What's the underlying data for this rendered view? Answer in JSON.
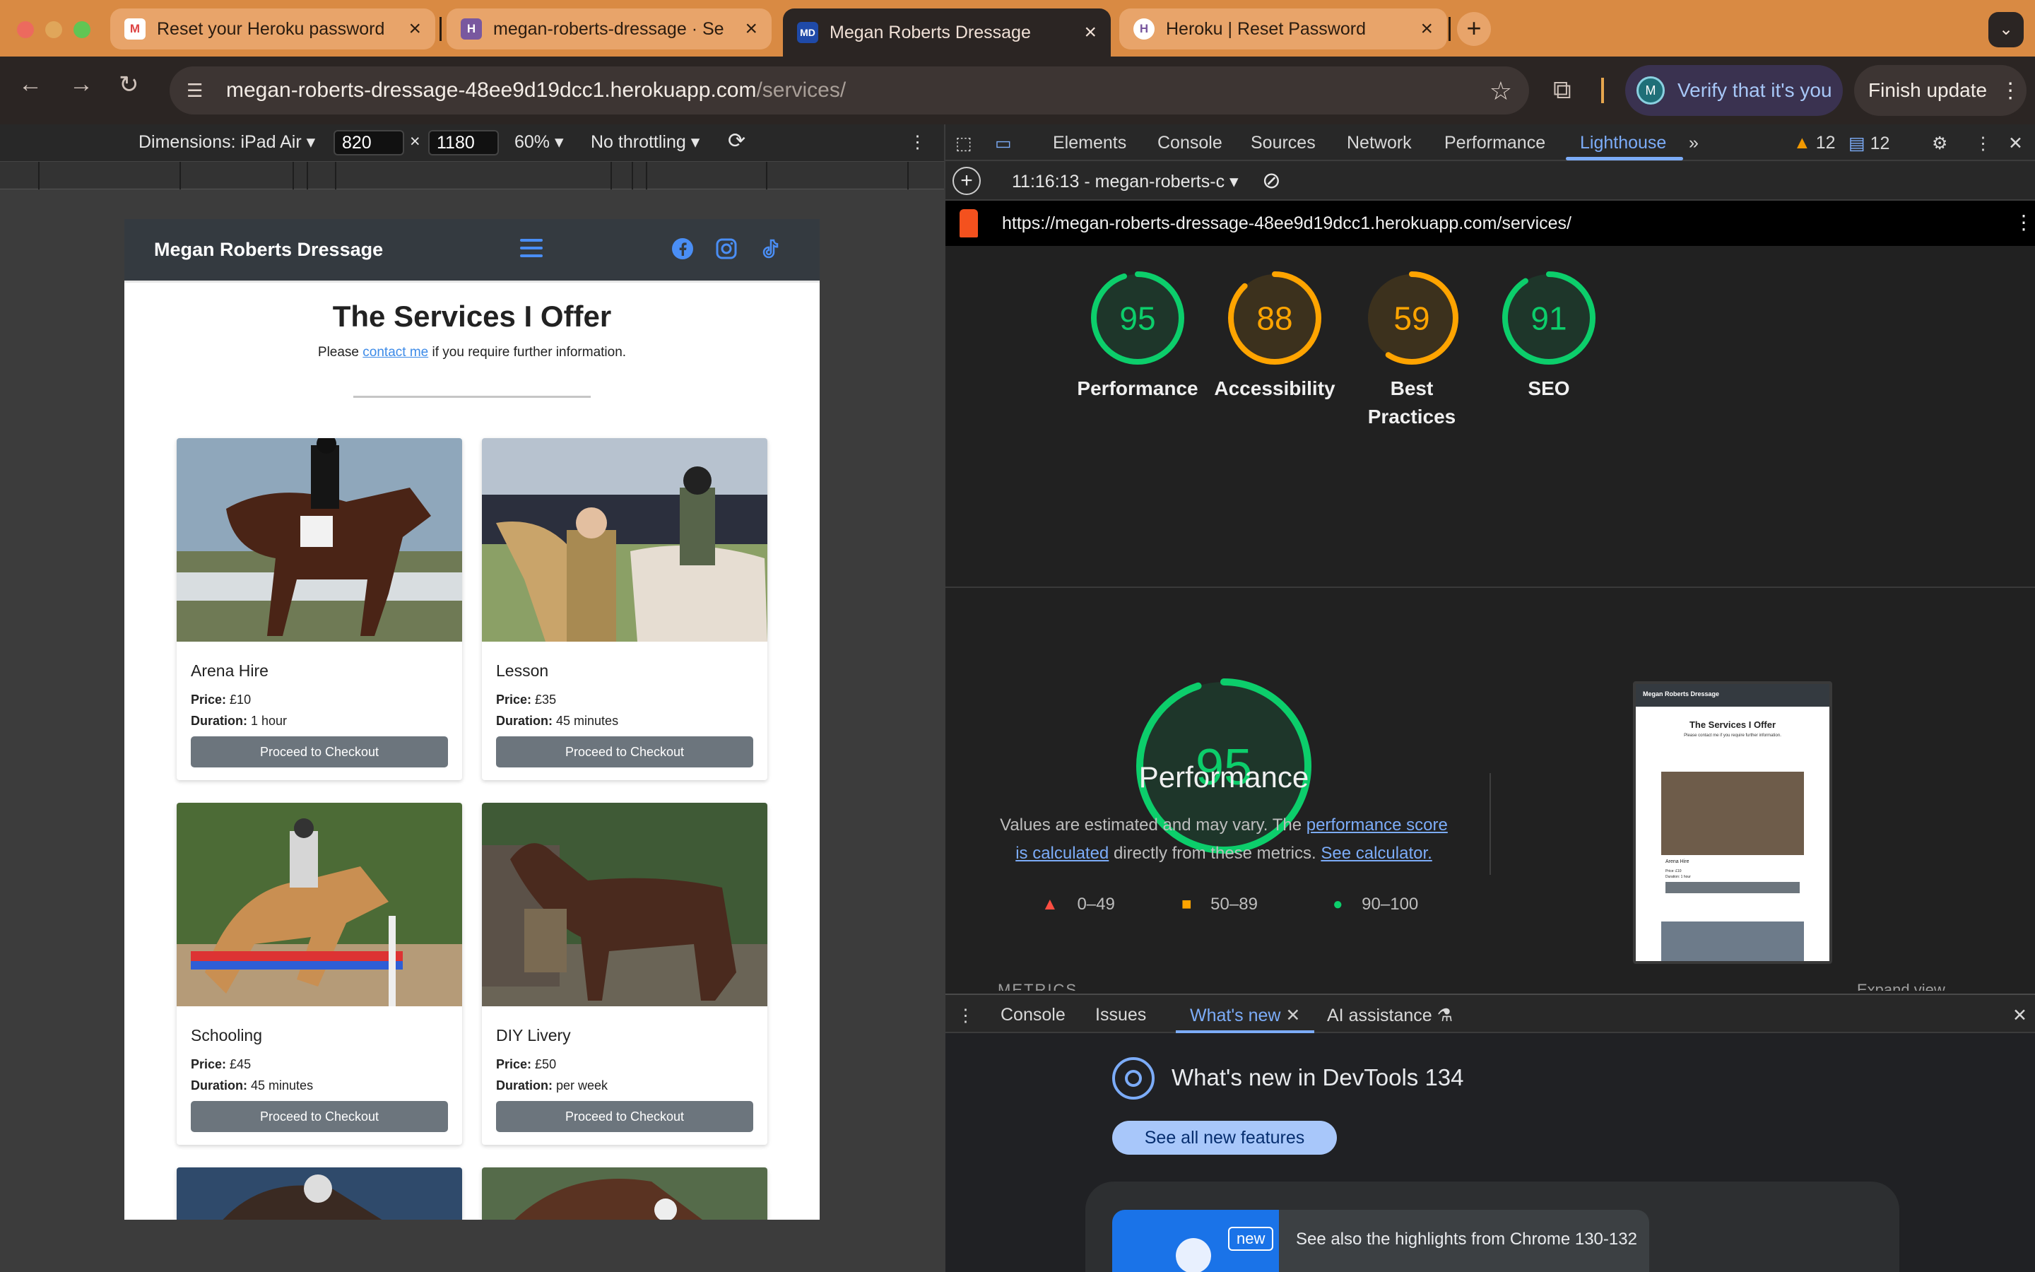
{
  "browser": {
    "tabs": [
      {
        "label": "Reset your Heroku password",
        "favicon": "gmail-icon"
      },
      {
        "label": "megan-roberts-dressage · Se",
        "favicon": "heroku-icon"
      },
      {
        "label": "Megan Roberts Dressage",
        "favicon": "site-icon",
        "favicon_text": "MD"
      },
      {
        "label": "Heroku | Reset Password",
        "favicon": "heroku-icon"
      }
    ],
    "url_host": "megan-roberts-dressage-48ee9d19dcc1.herokuapp.com",
    "url_path": "/services/",
    "verify_label": "Verify that it's you",
    "avatar_letter": "M",
    "finish_update_label": "Finish update",
    "accent": "#d98a43"
  },
  "device_toolbar": {
    "dimensions_label": "Dimensions: iPad Air",
    "width": "820",
    "times": "×",
    "height": "1180",
    "zoom": "60%",
    "throttling": "No throttling"
  },
  "site": {
    "brand": "Megan Roberts Dressage",
    "title": "The Services I Offer",
    "subtitle_before": "Please ",
    "subtitle_link": "contact me",
    "subtitle_after": " if you require further information.",
    "price_label": "Price:",
    "duration_label": "Duration:",
    "cards": [
      {
        "title": "Arena Hire",
        "price": "£10",
        "duration": "1 hour",
        "button": "Proceed to Checkout"
      },
      {
        "title": "Lesson",
        "price": "£35",
        "duration": "45 minutes",
        "button": "Proceed to Checkout"
      },
      {
        "title": "Schooling",
        "price": "£45",
        "duration": "45 minutes",
        "button": "Proceed to Checkout"
      },
      {
        "title": "DIY Livery",
        "price": "£50",
        "duration": "per week",
        "button": "Proceed to Checkout"
      }
    ]
  },
  "devtools": {
    "tabs": [
      "Elements",
      "Console",
      "Sources",
      "Network",
      "Performance",
      "Lighthouse"
    ],
    "warnings_count": "12",
    "messages_count": "12",
    "report_time": "11:16:13 - megan-roberts-c",
    "report_url": "https://megan-roberts-dressage-48ee9d19dcc1.herokuapp.com/services/",
    "scores": [
      {
        "label": "Performance",
        "value": 95,
        "color": "#0cce6b"
      },
      {
        "label": "Accessibility",
        "value": 88,
        "color": "#ffa400"
      },
      {
        "label": "Best Practices",
        "value": 59,
        "color": "#ffa400"
      },
      {
        "label": "SEO",
        "value": 91,
        "color": "#0cce6b"
      }
    ],
    "big_score": {
      "label": "Performance",
      "value": 95,
      "color": "#0cce6b"
    },
    "desc_prefix": "Values are estimated and may vary. The ",
    "desc_link1": "performance score is calculated",
    "desc_mid": " directly from these metrics. ",
    "desc_link2": "See calculator.",
    "legend": [
      "0–49",
      "50–89",
      "90–100"
    ],
    "metrics_heading": "METRICS",
    "expand_label": "Expand view",
    "screenshot_title": "The Services I Offer",
    "screenshot_subtitle": "Please contact me if you require further information.",
    "screenshot_card_title": "Arena Hire",
    "screenshot_card_price": "Price: £10",
    "screenshot_card_duration": "Duration: 1 hour",
    "drawer_tabs": [
      "Console",
      "Issues",
      "What's new",
      "AI assistance"
    ],
    "whats_new_title": "What's new in DevTools 134",
    "see_all_label": "See all new features",
    "new_badge": "new",
    "highlights_text": "See also the highlights from Chrome 130-132"
  }
}
